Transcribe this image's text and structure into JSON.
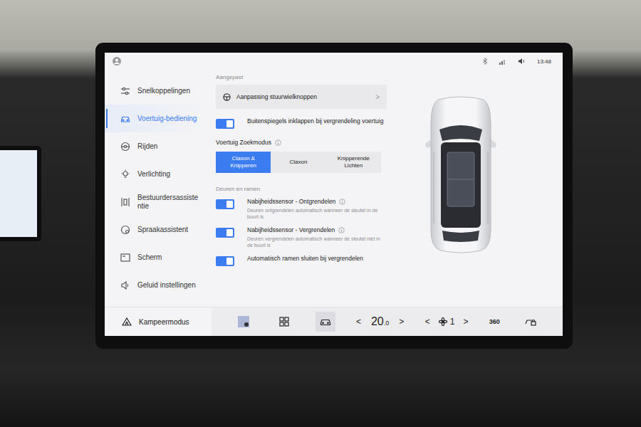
{
  "status_bar": {
    "time": "13:48"
  },
  "sidebar": {
    "items": [
      {
        "label": "Snelkoppelingen",
        "selected": false
      },
      {
        "label": "Voertuig-bediening",
        "selected": true
      },
      {
        "label": "Rijden",
        "selected": false
      },
      {
        "label": "Verlichting",
        "selected": false
      },
      {
        "label": "Bestuurdersassistentie",
        "selected": false
      },
      {
        "label": "Spraakassistent",
        "selected": false
      },
      {
        "label": "Scherm",
        "selected": false
      },
      {
        "label": "Geluid instellingen",
        "selected": false
      }
    ]
  },
  "custom": {
    "header": "Aangepast",
    "link": {
      "label": "Aanpassing stuurwielknoppen",
      "chevron": ">"
    },
    "toggle": {
      "label": "Buitenspiegels inklappen bij vergrendeling voertuig",
      "on": true
    }
  },
  "search_mode": {
    "title": "Voertuig Zoekmodus",
    "options": [
      {
        "label": "Claxon & Knipperen",
        "selected": true
      },
      {
        "label": "Claxon",
        "selected": false
      },
      {
        "label": "Knipperende Lichten",
        "selected": false
      }
    ]
  },
  "doors": {
    "header": "Deuren en ramen",
    "toggles": [
      {
        "label": "Nabijheidssensor - Ontgrendelen",
        "description": "Deuren ontgrendelen automatisch wanneer de sleutel in de buurt is",
        "on": true,
        "info": true
      },
      {
        "label": "Nabijheidssensor - Vergrendelen",
        "description": "Deuren vergrendelen automatisch wanneer de sleutel niet in de buurt is",
        "on": true,
        "info": true
      },
      {
        "label": "Automatisch ramen sluiten bij vergrendelen",
        "on": true,
        "info": false
      }
    ]
  },
  "bottom_bar": {
    "camp_mode": "Kampeermodus",
    "car_button_selected": true,
    "temp_prev": "<",
    "temperature": "20",
    "temperature_decimal": ".0",
    "temp_next": ">",
    "fan_prev": "<",
    "fan_speed": "1",
    "fan_next": ">",
    "view_360": "360"
  }
}
